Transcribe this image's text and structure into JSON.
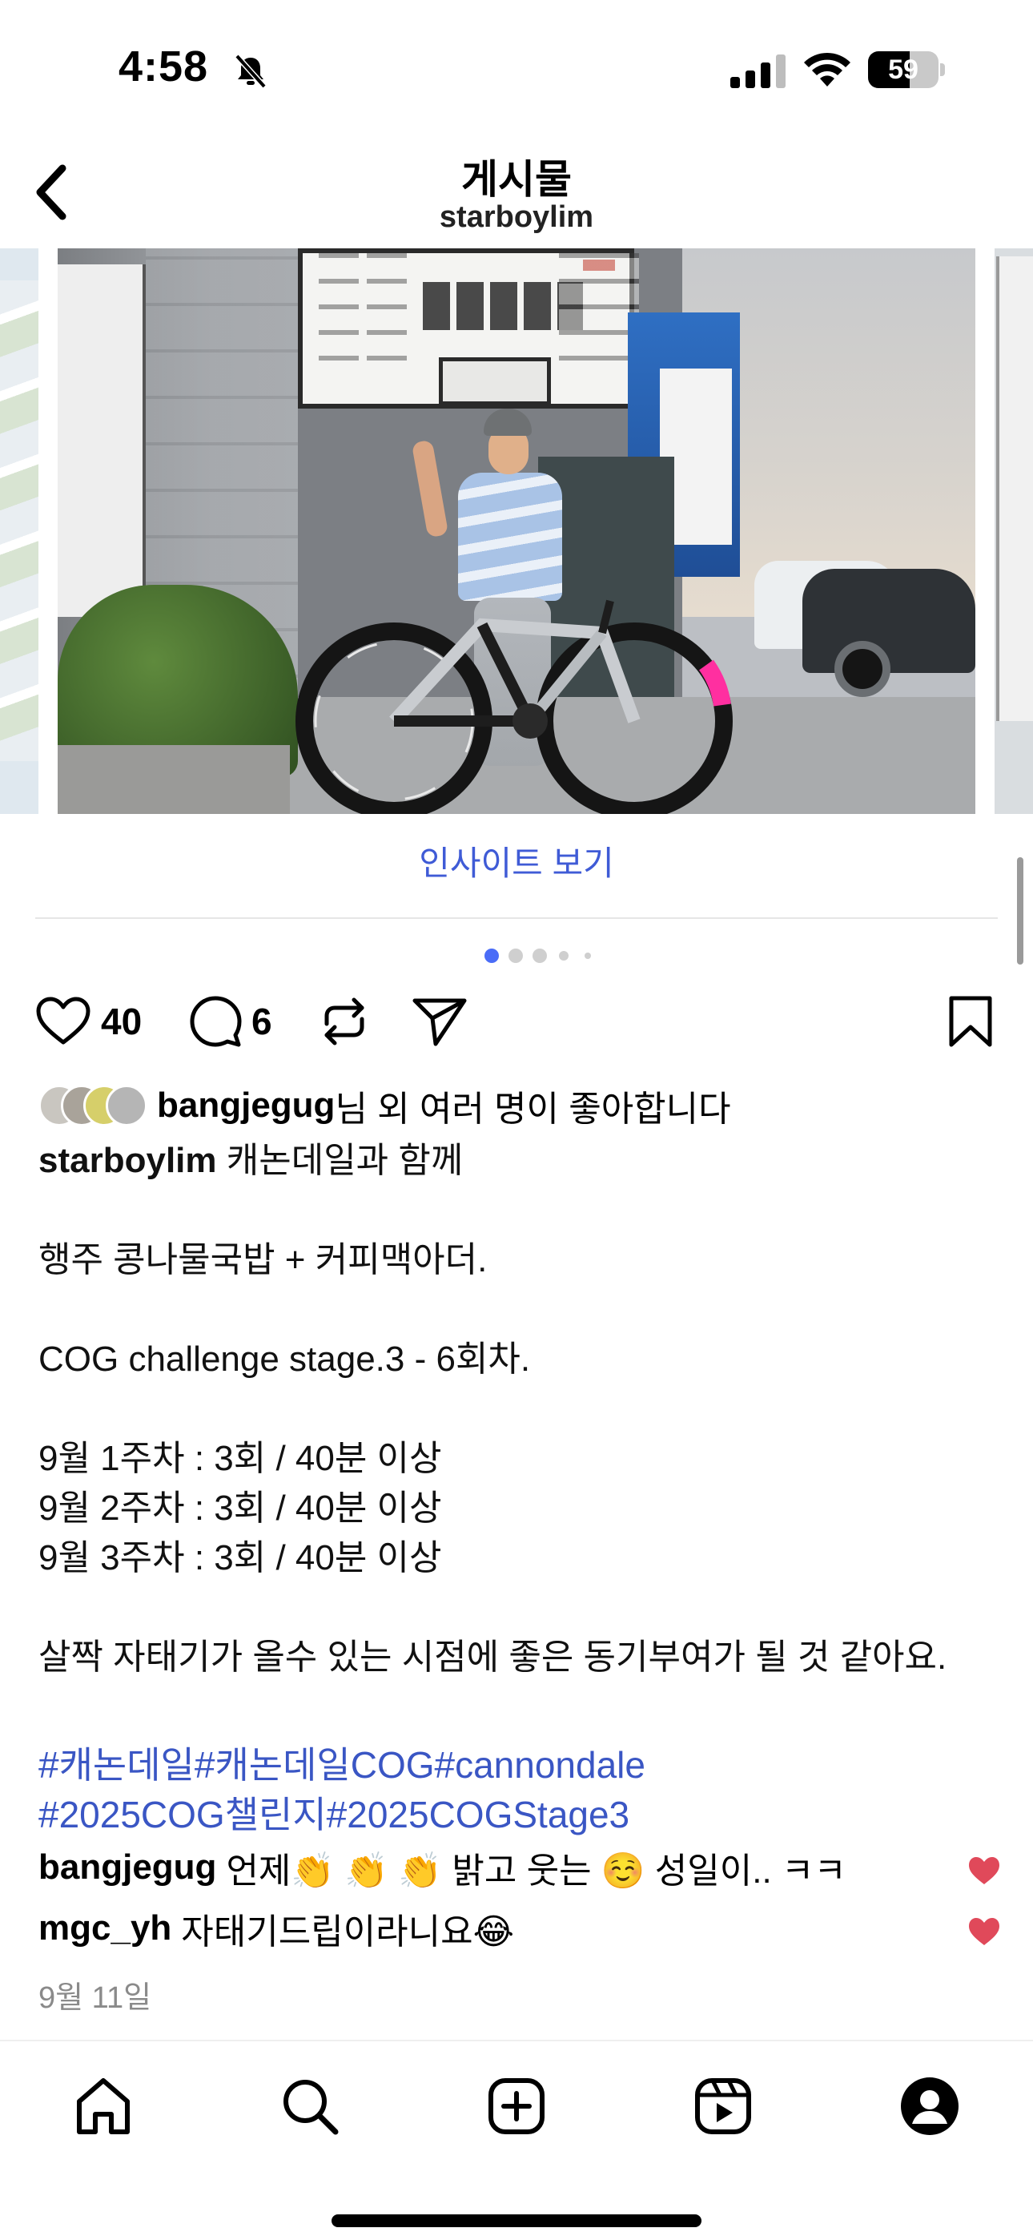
{
  "status_bar": {
    "time": "4:58",
    "battery": "59",
    "battery_level": 0.59
  },
  "header": {
    "title": "게시물",
    "username": "starboylim"
  },
  "post": {
    "insight_link": "인사이트 보기",
    "carousel": {
      "count": 5,
      "active_index": 0
    },
    "likes_count": "40",
    "comments_count": "6",
    "liked_by": {
      "user": "bangjegug",
      "suffix": "님 외 여러 명이 좋아합니다"
    },
    "caption": {
      "user": "starboylim",
      "first_line": "캐논데일과 함께",
      "lines": [
        "",
        "행주 콩나물국밥 + 커피맥아더.",
        "",
        "COG challenge stage.3 - 6회차.",
        "",
        "9월 1주차 : 3회 / 40분 이상",
        "9월 2주차 : 3회 / 40분 이상",
        "9월 3주차 : 3회 / 40분 이상",
        "",
        "살짝 자태기가 올수 있는 시점에 좋은 동기부여가 될 것 같아요.",
        ""
      ]
    },
    "hashtags": [
      "#캐논데일#캐논데일COG#cannondale",
      "#2025COG챌린지#2025COGStage3"
    ],
    "comments": [
      {
        "user": "bangjegug",
        "text": "언제👏 👏 👏 밝고 웃는 ☺️ 성일이.. ㅋㅋ"
      },
      {
        "user": "mgc_yh",
        "text": "자태기드립이라니요😂"
      }
    ],
    "date": "9월 11일"
  },
  "colors": {
    "link_blue": "#3f5bd6",
    "hashtag_blue": "#3a56c4",
    "heart_red": "#e0495a",
    "active_dot": "#4a6cf7",
    "muted": "#8a8a8a"
  },
  "icons": {
    "back": "chevron-left-icon",
    "like": "heart-outline-icon",
    "comment": "speech-bubble-icon",
    "repost": "repost-icon",
    "share": "paper-plane-icon",
    "save": "bookmark-icon",
    "nav": [
      "home-icon",
      "search-icon",
      "create-icon",
      "reels-icon",
      "profile-icon"
    ]
  }
}
